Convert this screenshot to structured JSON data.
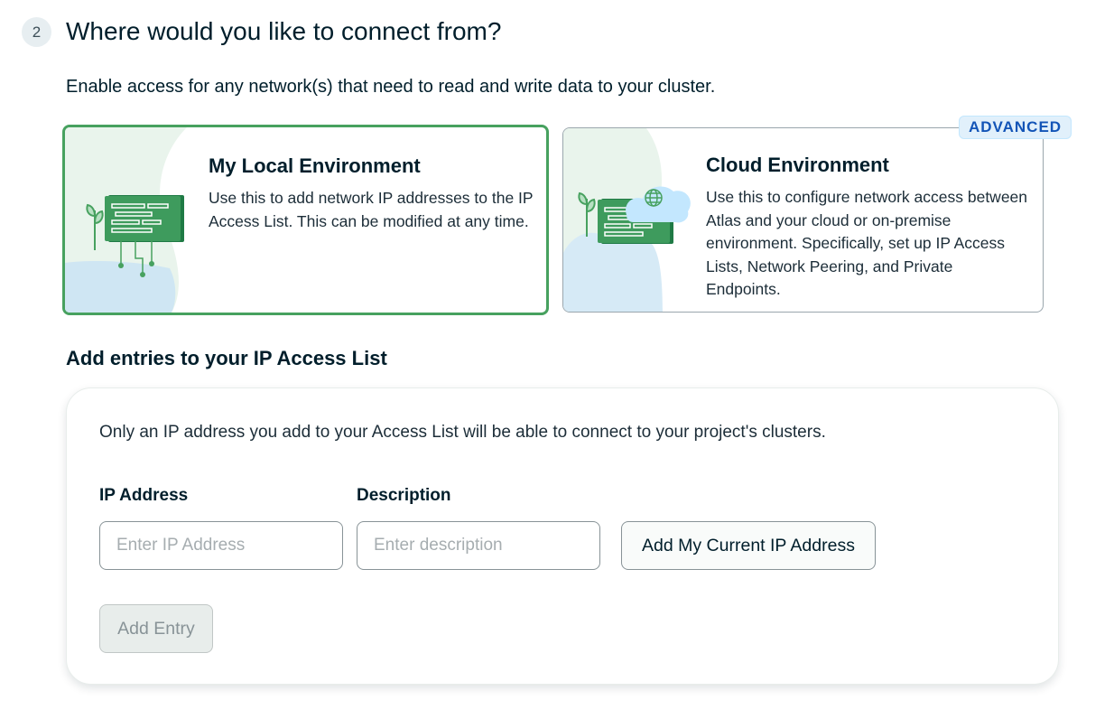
{
  "step": {
    "number": "2",
    "title": "Where would you like to connect from?",
    "subtitle": "Enable access for any network(s) that need to read and write data to your cluster."
  },
  "environments": {
    "local": {
      "title": "My Local Environment",
      "description": "Use this to add network IP addresses to the IP Access List. This can be modified at any time.",
      "selected": true,
      "icon": "local-environment-illustration"
    },
    "cloud": {
      "title": "Cloud Environment",
      "description": "Use this to configure network access between Atlas and your cloud or on-premise environment. Specifically, set up IP Access Lists, Network Peering, and Private Endpoints.",
      "badge": "ADVANCED",
      "selected": false,
      "icon": "cloud-environment-illustration"
    }
  },
  "access_list": {
    "heading": "Add entries to your IP Access List",
    "info": "Only an IP address you add to your Access List will be able to connect to your project's clusters.",
    "ip_field": {
      "label": "IP Address",
      "placeholder": "Enter IP Address",
      "value": ""
    },
    "description_field": {
      "label": "Description",
      "placeholder": "Enter description",
      "value": ""
    },
    "add_current_ip_label": "Add My Current IP Address",
    "add_entry_label": "Add Entry"
  },
  "colors": {
    "selected_border": "#47a15f",
    "badge_text": "#1254b7",
    "badge_bg": "#e1f0fb"
  }
}
